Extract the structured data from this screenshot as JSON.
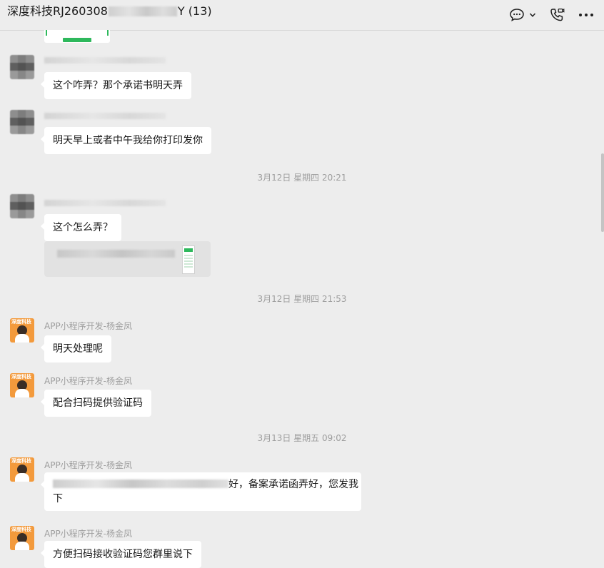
{
  "header": {
    "title_prefix": "深度科技RJ260308",
    "title_suffix": "Y (13)",
    "icons": [
      "chat-bubble-icon",
      "chevron-down-icon",
      "video-call-icon",
      "more-icon"
    ]
  },
  "messages": {
    "m1": {
      "text": "这个咋弄？那个承诺书明天弄"
    },
    "m2": {
      "text": "明天早上或者中午我给你打印发你"
    },
    "time1": "3月12日 星期四 20:21",
    "m3": {
      "text": "这个怎么弄？"
    },
    "time2": "3月12日 星期四 21:53",
    "m4": {
      "sender": "APP小程序开发-杨金凤",
      "text": "明天处理呢"
    },
    "m5": {
      "sender": "APP小程序开发-杨金凤",
      "text": "配合扫码提供验证码"
    },
    "time3": "3月13日 星期五 09:02",
    "m6": {
      "sender": "APP小程序开发-杨金凤",
      "text_visible": "好，备案承诺函弄好，您发我",
      "text_line2": "下"
    },
    "m7": {
      "sender": "APP小程序开发-杨金凤",
      "text": "方便扫码接收验证码您群里说下"
    }
  },
  "avatar_brand_text": "深度科技",
  "colors": {
    "background": "#ededed",
    "bubble": "#ffffff",
    "meta_text": "#9e9e9e",
    "accent_green": "#2eb85c",
    "avatar_orange": "#f39a3c"
  }
}
